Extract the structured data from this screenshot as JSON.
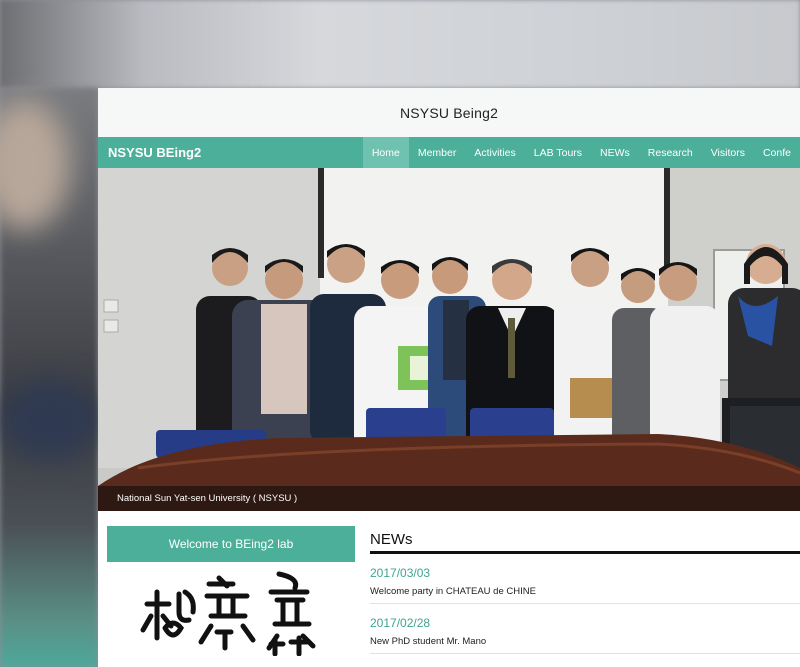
{
  "site": {
    "title": "NSYSU Being2"
  },
  "navbar": {
    "brand": "NSYSU BEing2",
    "items": [
      {
        "label": "Home",
        "active": true
      },
      {
        "label": "Member",
        "active": false
      },
      {
        "label": "Activities",
        "active": false
      },
      {
        "label": "LAB Tours",
        "active": false
      },
      {
        "label": "NEWs",
        "active": false
      },
      {
        "label": "Research",
        "active": false
      },
      {
        "label": "Visitors",
        "active": false
      },
      {
        "label": "Confe",
        "active": false
      }
    ]
  },
  "hero": {
    "caption": "National Sun Yat-sen University ( NSYSU )"
  },
  "sidebar": {
    "welcome": "Welcome to BEing2 lab"
  },
  "news": {
    "heading": "NEWs",
    "items": [
      {
        "date": "2017/03/03",
        "title": "Welcome party in CHATEAU de CHINE"
      },
      {
        "date": "2017/02/28",
        "title": "New PhD student Mr. Mano"
      }
    ]
  },
  "colors": {
    "accent": "#4caf9a",
    "active_nav": "#6fc1b0",
    "news_date": "#3ea58f"
  }
}
